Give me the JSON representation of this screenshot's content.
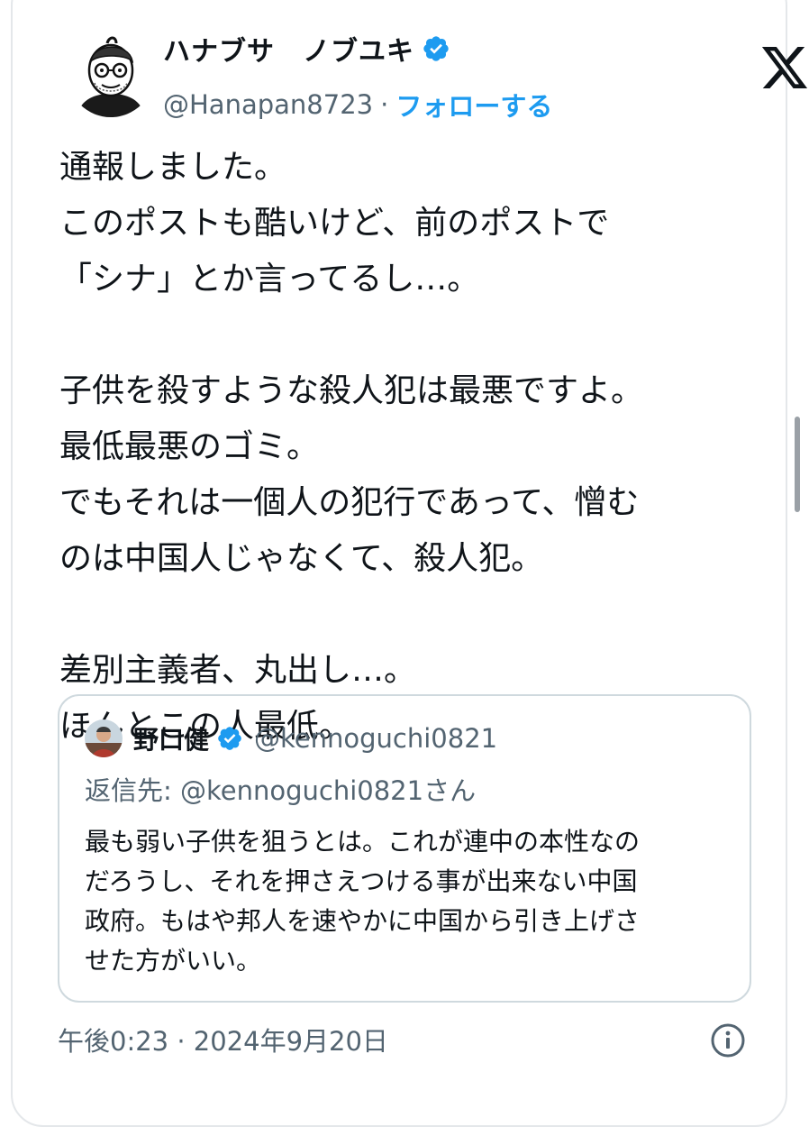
{
  "author": {
    "display_name": "ハナブサ　ノブユキ",
    "handle": "@Hanapan8723",
    "separator": "·",
    "follow_label": "フォローする"
  },
  "icons": {
    "avatar": "cartoon-avatar-icon",
    "verified": "verified-badge-icon",
    "brand": "x-logo-icon",
    "info": "info-icon"
  },
  "colors": {
    "accent": "#1d9bf0",
    "text": "#0f1419",
    "muted": "#536471",
    "border": "#cfd9de"
  },
  "post": {
    "text": "通報しました。\nこのポストも酷いけど、前のポストで\n「シナ」とか言ってるし…。\n\n子供を殺すような殺人犯は最悪ですよ。\n最低最悪のゴミ。\nでもそれは一個人の犯行であって、憎む\nのは中国人じゃなくて、殺人犯。\n\n差別主義者、丸出し…。\nほんとこの人最低。"
  },
  "quoted_post": {
    "display_name": "野口健",
    "handle": "@kennoguchi0821",
    "reply_to": "返信先: @kennoguchi0821さん",
    "text": "最も弱い子供を狙うとは。これが連中の本性なの\nだろうし、それを押さえつける事が出来ない中国\n政府。もはや邦人を速やかに中国から引き上げさ\nせた方がいい。"
  },
  "timestamp": "午後0:23 · 2024年9月20日"
}
